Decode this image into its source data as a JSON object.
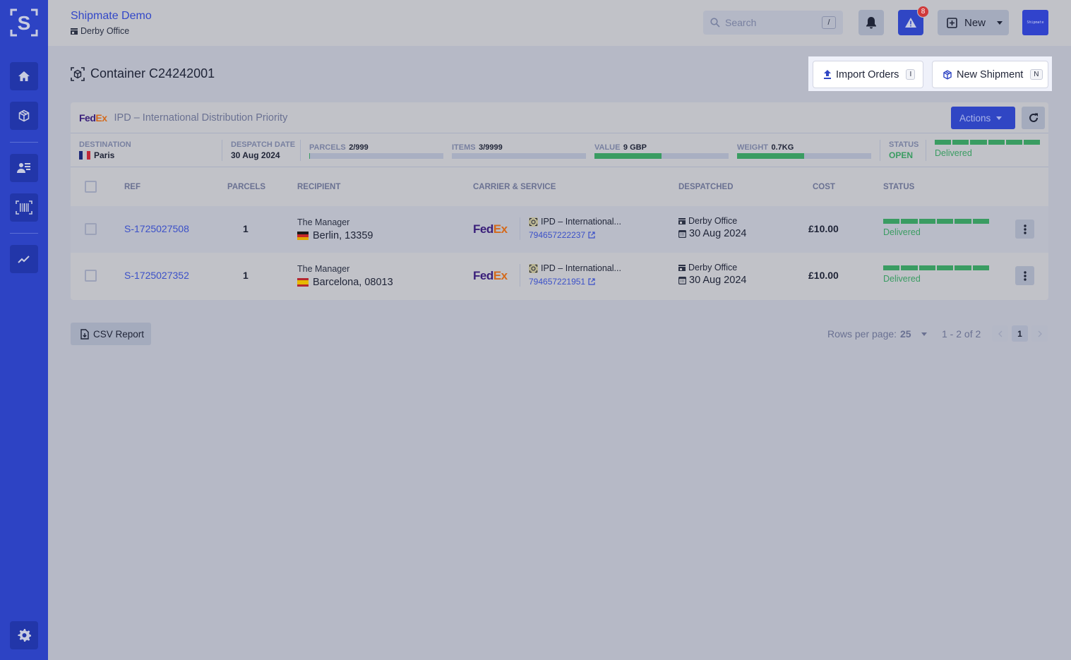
{
  "app": {
    "org_name": "Shipmate Demo",
    "location": "Derby Office",
    "avatar_text": "Shipmate"
  },
  "sidebar": {
    "items": [
      {
        "name": "home",
        "icon": "home-icon"
      },
      {
        "name": "shipments",
        "icon": "package-icon"
      },
      {
        "name": "contacts",
        "icon": "contacts-icon"
      },
      {
        "name": "scan",
        "icon": "barcode-icon"
      },
      {
        "name": "analytics",
        "icon": "chart-line-icon"
      },
      {
        "name": "settings",
        "icon": "gear-icon"
      }
    ]
  },
  "topbar": {
    "search_placeholder": "Search",
    "search_shortcut": "/",
    "alerts_count": "8",
    "new_label": "New"
  },
  "page": {
    "title": "Container C24242001",
    "import_orders_label": "Import Orders",
    "import_orders_shortcut": "I",
    "new_shipment_label": "New Shipment",
    "new_shipment_shortcut": "N"
  },
  "container": {
    "carrier_logo": {
      "fe": "Fed",
      "ex": "Ex"
    },
    "service": "IPD – International Distribution Priority",
    "actions_label": "Actions",
    "stats": {
      "destination_label": "DESTINATION",
      "destination": "Paris",
      "despatch_date_label": "DESPATCH DATE",
      "despatch_date": "30 Aug 2024",
      "parcels_label": "PARCELS",
      "parcels": "2/999",
      "parcels_fill": 0.002,
      "items_label": "ITEMS",
      "items": "3/9999",
      "items_fill": 0.0003,
      "value_label": "VALUE",
      "value": "9 GBP",
      "value_fill": 0.5,
      "weight_label": "WEIGHT",
      "weight": "0.7KG",
      "weight_fill": 0.5,
      "status_label": "STATUS",
      "status": "OPEN",
      "tracking_status": "Delivered",
      "tracking_steps_complete": 6,
      "tracking_steps_total": 6
    }
  },
  "table": {
    "columns": [
      "REF",
      "PARCELS",
      "RECIPIENT",
      "CARRIER & SERVICE",
      "DESPATCHED",
      "COST",
      "STATUS"
    ],
    "rows": [
      {
        "ref": "S-1725027508",
        "parcels": "1",
        "recipient_name": "The Manager",
        "recipient_city": "Berlin, 13359",
        "recipient_country": "DE",
        "carrier": "FedEx",
        "service": "IPD – International...",
        "tracking": "794657222237",
        "despatch_location": "Derby Office",
        "despatch_date": "30 Aug 2024",
        "cost": "£10.00",
        "status": "Delivered"
      },
      {
        "ref": "S-1725027352",
        "parcels": "1",
        "recipient_name": "The Manager",
        "recipient_city": "Barcelona, 08013",
        "recipient_country": "ES",
        "carrier": "FedEx",
        "service": "IPD – International...",
        "tracking": "794657221951",
        "despatch_location": "Derby Office",
        "despatch_date": "30 Aug 2024",
        "cost": "£10.00",
        "status": "Delivered"
      }
    ]
  },
  "footer": {
    "csv_label": "CSV Report",
    "rows_per_page_label": "Rows per page:",
    "rows_per_page": "25",
    "range": "1 - 2 of 2",
    "current_page": "1"
  }
}
